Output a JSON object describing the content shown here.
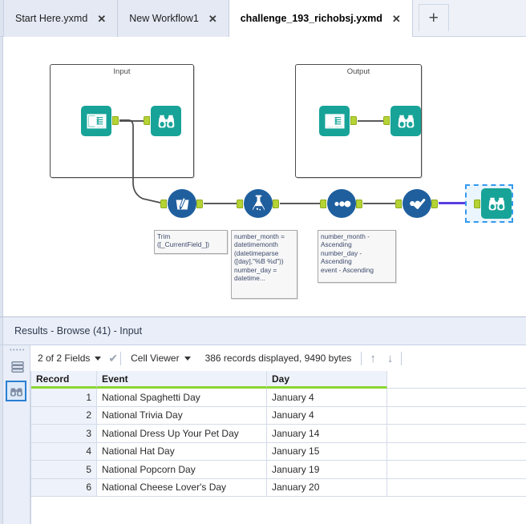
{
  "tabs": [
    {
      "label": "Start Here.yxmd",
      "close": "✕",
      "active": false
    },
    {
      "label": "New Workflow1",
      "close": "✕",
      "active": false
    },
    {
      "label": "challenge_193_richobsj.yxmd",
      "close": "✕",
      "active": true
    }
  ],
  "tab_add_label": "+",
  "canvas": {
    "containers": [
      {
        "title": "Input"
      },
      {
        "title": "Output"
      }
    ],
    "annotations": [
      {
        "text": "Trim\n([_CurrentField_])"
      },
      {
        "text": "number_month =\ndatetimemonth\n(datetimeparse\n([day],\"%B %d\"))\nnumber_day =\ndatetime..."
      },
      {
        "text": "number_month -\nAscending\nnumber_day -\nAscending\nevent - Ascending"
      }
    ],
    "tools": [
      {
        "name": "text-input-tool",
        "icon": "book-icon"
      },
      {
        "name": "browse-tool",
        "icon": "binoculars-icon"
      },
      {
        "name": "data-cleansing-tool",
        "icon": "cleansing-icon"
      },
      {
        "name": "formula-tool",
        "icon": "flask-icon"
      },
      {
        "name": "sort-tool",
        "icon": "sort-dots-icon"
      },
      {
        "name": "select-tool",
        "icon": "check-icon"
      },
      {
        "name": "browse-tool-selected",
        "icon": "binoculars-icon"
      }
    ]
  },
  "results": {
    "title": "Results - Browse (41) - Input",
    "toolbar": {
      "fields": "2 of 2 Fields",
      "check": "✔",
      "viewer": "Cell Viewer",
      "records": "386 records displayed, 9490 bytes",
      "arrow_up": "↑",
      "arrow_down": "↓"
    },
    "columns": [
      "Record",
      "Event",
      "Day"
    ],
    "rows": [
      {
        "record": "1",
        "event": "National Spaghetti Day",
        "day": "January 4"
      },
      {
        "record": "2",
        "event": "National Trivia Day",
        "day": "January 4"
      },
      {
        "record": "3",
        "event": "National Dress Up Your Pet Day",
        "day": "January 14"
      },
      {
        "record": "4",
        "event": "National Hat Day",
        "day": "January 15"
      },
      {
        "record": "5",
        "event": "National Popcorn Day",
        "day": "January 19"
      },
      {
        "record": "6",
        "event": "National Cheese Lover's Day",
        "day": "January 20"
      }
    ]
  },
  "colors": {
    "teal": "#17a398",
    "blue": "#1f5f9e",
    "port_green": "#b5d334",
    "header_underline": "#8ad632",
    "selection": "#3399ee"
  }
}
